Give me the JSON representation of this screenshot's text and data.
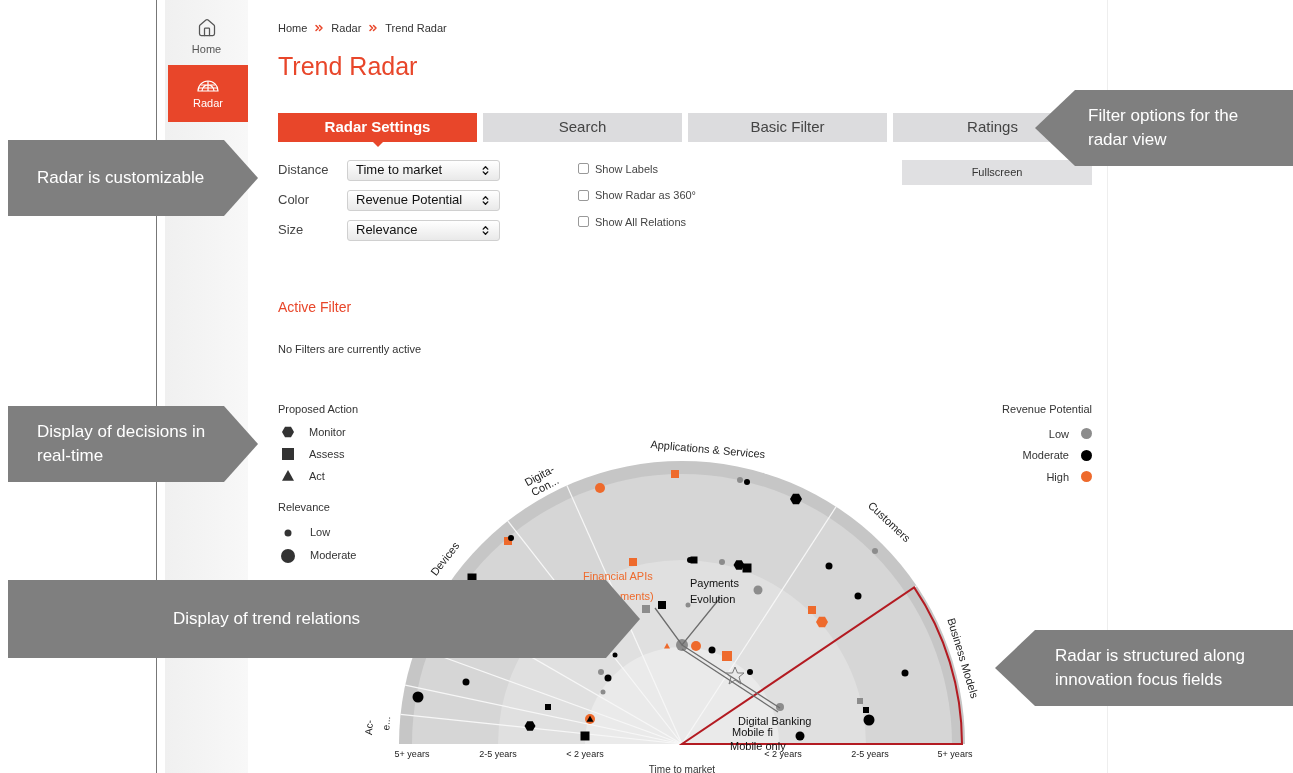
{
  "sidebar": {
    "items": [
      {
        "label": "Home",
        "selected": false
      },
      {
        "label": "Radar",
        "selected": true
      }
    ]
  },
  "breadcrumb": [
    "Home",
    "Radar",
    "Trend Radar"
  ],
  "title": "Trend Radar",
  "tabs": [
    {
      "label": "Radar Settings",
      "selected": true
    },
    {
      "label": "Search",
      "selected": false
    },
    {
      "label": "Basic Filter",
      "selected": false
    },
    {
      "label": "Ratings",
      "selected": false
    }
  ],
  "settings": [
    {
      "label": "Distance",
      "value": "Time to market"
    },
    {
      "label": "Color",
      "value": "Revenue Potential"
    },
    {
      "label": "Size",
      "value": "Relevance"
    }
  ],
  "options": [
    {
      "label": "Show Labels",
      "checked": false
    },
    {
      "label": "Show Radar as 360°",
      "checked": false
    },
    {
      "label": "Show All Relations",
      "checked": false
    }
  ],
  "fullscreen_button": "Fullscreen",
  "active_filter": {
    "title": "Active Filter",
    "message": "No Filters are currently active"
  },
  "legend_action": {
    "title": "Proposed Action",
    "items": [
      {
        "label": "Monitor",
        "kind": "hexagon"
      },
      {
        "label": "Assess",
        "kind": "square"
      },
      {
        "label": "Act",
        "kind": "triangle"
      }
    ]
  },
  "legend_relevance": {
    "title": "Relevance",
    "items": [
      {
        "label": "Low",
        "kind": "small"
      },
      {
        "label": "Moderate",
        "kind": "medium"
      }
    ]
  },
  "legend_revenue": {
    "title": "Revenue Potential",
    "items": [
      {
        "label": "Low",
        "color": "#8c8c8c"
      },
      {
        "label": "Moderate",
        "color": "#000000"
      },
      {
        "label": "High",
        "color": "#ee6a2c"
      }
    ]
  },
  "radar": {
    "segments": [
      {
        "lines": [
          "Business Models"
        ]
      },
      {
        "lines": [
          "Customers"
        ]
      },
      {
        "lines": [
          "Applications & Services"
        ]
      },
      {
        "lines": [
          "Digita-",
          "Con..."
        ]
      },
      {
        "lines": [
          "Devices"
        ]
      },
      {
        "lines": [
          "e..."
        ]
      },
      {
        "lines": [
          "Ac-"
        ]
      }
    ],
    "rings_left": [
      "5+ years",
      "2-5 years",
      "< 2 years"
    ],
    "rings_right": [
      "< 2 years",
      "2-5 years",
      "5+ years"
    ],
    "axis_title": "Time to market",
    "trend_labels": [
      {
        "text": "Financial APIs",
        "kind": "highlight"
      },
      {
        "text": "ments)",
        "kind": "highlight"
      },
      {
        "text": "Payments",
        "kind": "normal"
      },
      {
        "text": "Evolution",
        "kind": "normal"
      },
      {
        "text": "Digital Banking",
        "kind": "normal"
      },
      {
        "text": "Mobile fi",
        "kind": "normal"
      },
      {
        "text": "Mobile only",
        "kind": "normal"
      }
    ]
  },
  "callouts": [
    {
      "text": "Radar is customizable",
      "kind": "right"
    },
    {
      "text": "Filter options for the radar view",
      "kind": "left"
    },
    {
      "text": "Display of decisions in real-time",
      "kind": "right"
    },
    {
      "text": "Display of trend relations",
      "kind": "right"
    },
    {
      "text": "Radar is structured along innovation focus fields",
      "kind": "left"
    }
  ]
}
